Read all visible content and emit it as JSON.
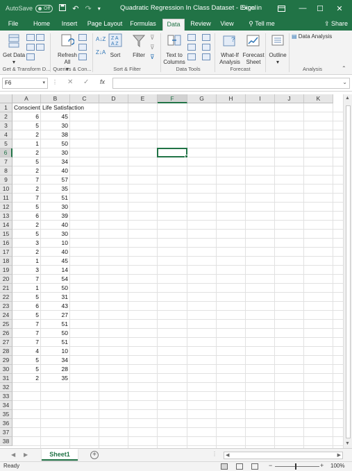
{
  "titlebar": {
    "autosave_label": "AutoSave",
    "autosave_state": "Off",
    "doc_title": "Quadratic Regression In Class Dataset  -  Excel",
    "sign_in": "Sign in",
    "color": "#217346"
  },
  "ribbon_tabs": [
    {
      "label": "File"
    },
    {
      "label": "Home"
    },
    {
      "label": "Insert"
    },
    {
      "label": "Page Layout"
    },
    {
      "label": "Formulas"
    },
    {
      "label": "Data"
    },
    {
      "label": "Review"
    },
    {
      "label": "View"
    },
    {
      "label": "Tell me"
    },
    {
      "label": "Share"
    }
  ],
  "active_tab": "Data",
  "ribbon": {
    "get_data": "Get Data",
    "refresh_all": "Refresh All",
    "sort": "Sort",
    "filter": "Filter",
    "text_to_columns": "Text to Columns",
    "what_if": "What-If Analysis",
    "forecast_sheet": "Forecast Sheet",
    "outline": "Outline",
    "data_analysis": "Data Analysis",
    "groups": {
      "get_transform": "Get & Transform D...",
      "queries": "Queries & Con...",
      "sort_filter": "Sort & Filter",
      "data_tools": "Data Tools",
      "forecast": "Forecast",
      "analysis": "Analysis"
    }
  },
  "formula_bar": {
    "name_box": "F6",
    "fx": "fx",
    "content": ""
  },
  "columns": [
    "A",
    "B",
    "C",
    "D",
    "E",
    "F",
    "G",
    "H",
    "I",
    "J",
    "K"
  ],
  "selected_column": "F",
  "selected_row": 6,
  "rows": [
    "1",
    "2",
    "3",
    "4",
    "5",
    "6",
    "7",
    "8",
    "9",
    "10",
    "11",
    "12",
    "13",
    "14",
    "15",
    "16",
    "17",
    "18",
    "19",
    "20",
    "21",
    "22",
    "23",
    "24",
    "25",
    "26",
    "27",
    "28",
    "29",
    "30",
    "31",
    "32",
    "33",
    "34",
    "35",
    "36",
    "37",
    "38"
  ],
  "headers": {
    "a1": "Conscient",
    "b1": "Life Satisfaction"
  },
  "data": [
    [
      6,
      45
    ],
    [
      5,
      30
    ],
    [
      2,
      38
    ],
    [
      1,
      50
    ],
    [
      2,
      30
    ],
    [
      5,
      34
    ],
    [
      2,
      40
    ],
    [
      7,
      57
    ],
    [
      2,
      35
    ],
    [
      7,
      51
    ],
    [
      5,
      30
    ],
    [
      6,
      39
    ],
    [
      2,
      40
    ],
    [
      5,
      30
    ],
    [
      3,
      10
    ],
    [
      2,
      40
    ],
    [
      1,
      45
    ],
    [
      3,
      14
    ],
    [
      7,
      54
    ],
    [
      1,
      50
    ],
    [
      5,
      31
    ],
    [
      6,
      43
    ],
    [
      5,
      27
    ],
    [
      7,
      51
    ],
    [
      7,
      50
    ],
    [
      7,
      51
    ],
    [
      4,
      10
    ],
    [
      5,
      34
    ],
    [
      5,
      28
    ],
    [
      2,
      35
    ]
  ],
  "sheets": [
    "Sheet1"
  ],
  "status": {
    "ready": "Ready",
    "zoom": "100%"
  }
}
